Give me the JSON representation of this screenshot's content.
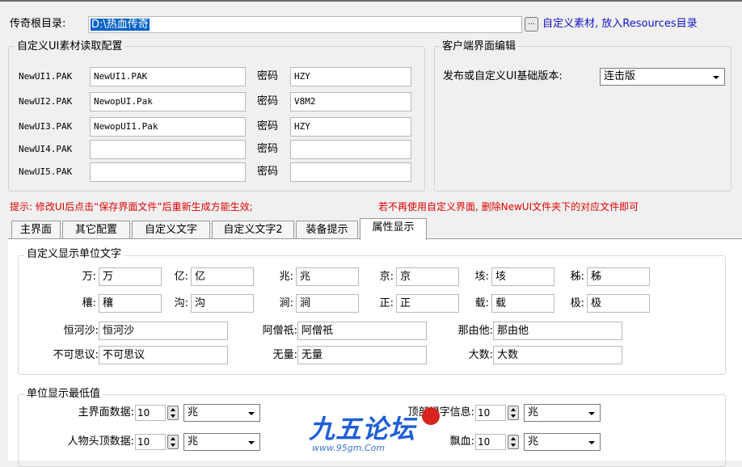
{
  "root": {
    "label": "传奇根目录:",
    "path": "D:\\热血传奇",
    "browse": "...",
    "hint": "自定义素材, 放入Resources目录"
  },
  "ui_group": {
    "title": "自定义UI素材读取配置",
    "pwd_label": "密码",
    "rows": [
      {
        "name": "NewUI1.PAK",
        "file": "NewUI1.PAK",
        "pwd": "HZY"
      },
      {
        "name": "NewUI2.PAK",
        "file": "NewopUI.Pak",
        "pwd": "V8M2"
      },
      {
        "name": "NewUI3.PAK",
        "file": "NewopUI1.Pak",
        "pwd": "HZY"
      },
      {
        "name": "NewUI4.PAK",
        "file": "",
        "pwd": ""
      },
      {
        "name": "NewUI5.PAK",
        "file": "",
        "pwd": ""
      }
    ]
  },
  "client_group": {
    "title": "客户端界面编辑",
    "version_label": "发布或自定义UI基础版本:",
    "version_value": "连击版"
  },
  "warning": {
    "left": "提示: 修改UI后点击“保存界面文件”后重新生成方能生效;",
    "right": "若不再使用自定义界面, 删除NewUI文件夹下的对应文件即可"
  },
  "tabs": [
    "主界面",
    "其它配置",
    "自定义文字",
    "自定义文字2",
    "装备提示",
    "属性显示"
  ],
  "unit_group": {
    "title": "自定义显示单位文字",
    "rows": [
      [
        {
          "k": "万:",
          "v": "万"
        },
        {
          "k": "亿:",
          "v": "亿"
        },
        {
          "k": "兆:",
          "v": "兆"
        },
        {
          "k": "京:",
          "v": "京"
        },
        {
          "k": "垓:",
          "v": "垓"
        },
        {
          "k": "秭:",
          "v": "秭"
        }
      ],
      [
        {
          "k": "穰:",
          "v": "穰"
        },
        {
          "k": "沟:",
          "v": "沟"
        },
        {
          "k": "涧:",
          "v": "涧"
        },
        {
          "k": "正:",
          "v": "正"
        },
        {
          "k": "载:",
          "v": "载"
        },
        {
          "k": "极:",
          "v": "极"
        }
      ],
      [
        {
          "k": "恒河沙:",
          "v": "恒河沙"
        },
        {
          "k": "阿僧祇:",
          "v": "阿僧祇"
        },
        {
          "k": "那由他:",
          "v": "那由他"
        }
      ],
      [
        {
          "k": "不可思议:",
          "v": "不可思议"
        },
        {
          "k": "无量:",
          "v": "无量"
        },
        {
          "k": "大数:",
          "v": "大数"
        }
      ]
    ]
  },
  "min_group": {
    "title": "单位显示最低值",
    "rows": [
      {
        "label": "主界面数据:",
        "value": "10",
        "unit": "兆"
      },
      {
        "label": "人物头顶数据:",
        "value": "10",
        "unit": "兆"
      },
      {
        "label": "顶部绿字信息:",
        "value": "10",
        "unit": "兆"
      },
      {
        "label": "飘血:",
        "value": "10",
        "unit": "兆"
      }
    ]
  },
  "watermark": {
    "text": "九五论坛",
    "url": "www.95gm.Com",
    "colors": {
      "main": "#1e5fd8",
      "accent": "#d8231e"
    }
  },
  "colors": {
    "link": "#1414c8",
    "warning": "#e00000",
    "selection": "#0a64c8"
  }
}
